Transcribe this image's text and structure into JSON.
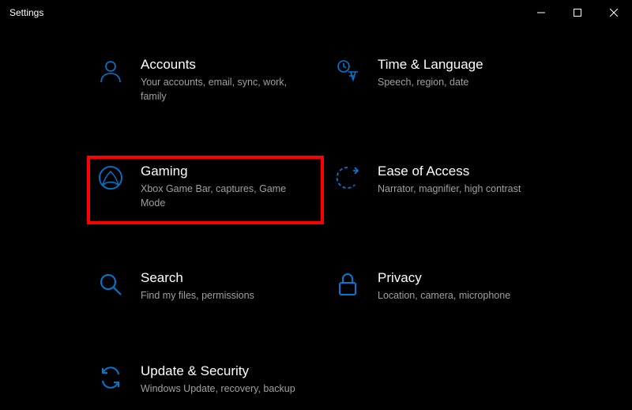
{
  "window": {
    "title": "Settings"
  },
  "categories": [
    {
      "key": "accounts",
      "title": "Accounts",
      "desc": "Your accounts, email, sync, work, family"
    },
    {
      "key": "time",
      "title": "Time & Language",
      "desc": "Speech, region, date"
    },
    {
      "key": "gaming",
      "title": "Gaming",
      "desc": "Xbox Game Bar, captures, Game Mode"
    },
    {
      "key": "ease",
      "title": "Ease of Access",
      "desc": "Narrator, magnifier, high contrast"
    },
    {
      "key": "search",
      "title": "Search",
      "desc": "Find my files, permissions"
    },
    {
      "key": "privacy",
      "title": "Privacy",
      "desc": "Location, camera, microphone"
    },
    {
      "key": "update",
      "title": "Update & Security",
      "desc": "Windows Update, recovery, backup"
    }
  ],
  "highlighted": "gaming",
  "accent": "#0078d4"
}
